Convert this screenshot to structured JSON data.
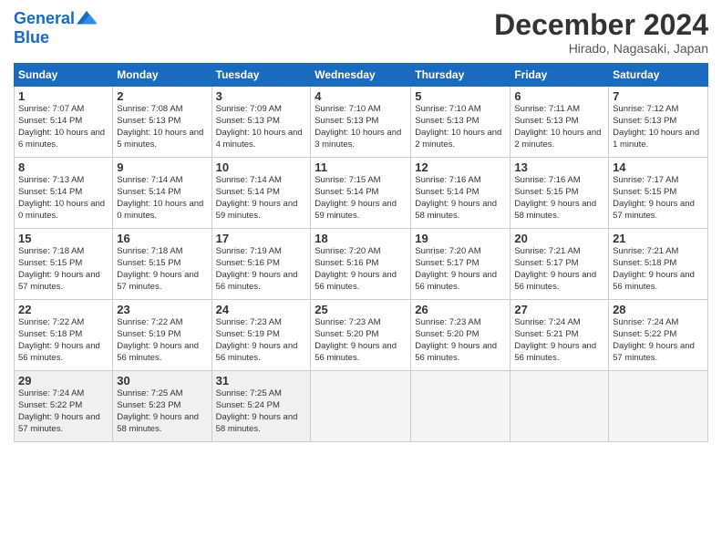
{
  "header": {
    "logo_line1": "General",
    "logo_line2": "Blue",
    "month": "December 2024",
    "location": "Hirado, Nagasaki, Japan"
  },
  "days_of_week": [
    "Sunday",
    "Monday",
    "Tuesday",
    "Wednesday",
    "Thursday",
    "Friday",
    "Saturday"
  ],
  "weeks": [
    [
      {
        "day": "1",
        "sunrise": "7:07 AM",
        "sunset": "5:14 PM",
        "daylight": "10 hours and 6 minutes."
      },
      {
        "day": "2",
        "sunrise": "7:08 AM",
        "sunset": "5:13 PM",
        "daylight": "10 hours and 5 minutes."
      },
      {
        "day": "3",
        "sunrise": "7:09 AM",
        "sunset": "5:13 PM",
        "daylight": "10 hours and 4 minutes."
      },
      {
        "day": "4",
        "sunrise": "7:10 AM",
        "sunset": "5:13 PM",
        "daylight": "10 hours and 3 minutes."
      },
      {
        "day": "5",
        "sunrise": "7:10 AM",
        "sunset": "5:13 PM",
        "daylight": "10 hours and 2 minutes."
      },
      {
        "day": "6",
        "sunrise": "7:11 AM",
        "sunset": "5:13 PM",
        "daylight": "10 hours and 2 minutes."
      },
      {
        "day": "7",
        "sunrise": "7:12 AM",
        "sunset": "5:13 PM",
        "daylight": "10 hours and 1 minute."
      }
    ],
    [
      {
        "day": "8",
        "sunrise": "7:13 AM",
        "sunset": "5:14 PM",
        "daylight": "10 hours and 0 minutes."
      },
      {
        "day": "9",
        "sunrise": "7:14 AM",
        "sunset": "5:14 PM",
        "daylight": "10 hours and 0 minutes."
      },
      {
        "day": "10",
        "sunrise": "7:14 AM",
        "sunset": "5:14 PM",
        "daylight": "9 hours and 59 minutes."
      },
      {
        "day": "11",
        "sunrise": "7:15 AM",
        "sunset": "5:14 PM",
        "daylight": "9 hours and 59 minutes."
      },
      {
        "day": "12",
        "sunrise": "7:16 AM",
        "sunset": "5:14 PM",
        "daylight": "9 hours and 58 minutes."
      },
      {
        "day": "13",
        "sunrise": "7:16 AM",
        "sunset": "5:15 PM",
        "daylight": "9 hours and 58 minutes."
      },
      {
        "day": "14",
        "sunrise": "7:17 AM",
        "sunset": "5:15 PM",
        "daylight": "9 hours and 57 minutes."
      }
    ],
    [
      {
        "day": "15",
        "sunrise": "7:18 AM",
        "sunset": "5:15 PM",
        "daylight": "9 hours and 57 minutes."
      },
      {
        "day": "16",
        "sunrise": "7:18 AM",
        "sunset": "5:15 PM",
        "daylight": "9 hours and 57 minutes."
      },
      {
        "day": "17",
        "sunrise": "7:19 AM",
        "sunset": "5:16 PM",
        "daylight": "9 hours and 56 minutes."
      },
      {
        "day": "18",
        "sunrise": "7:20 AM",
        "sunset": "5:16 PM",
        "daylight": "9 hours and 56 minutes."
      },
      {
        "day": "19",
        "sunrise": "7:20 AM",
        "sunset": "5:17 PM",
        "daylight": "9 hours and 56 minutes."
      },
      {
        "day": "20",
        "sunrise": "7:21 AM",
        "sunset": "5:17 PM",
        "daylight": "9 hours and 56 minutes."
      },
      {
        "day": "21",
        "sunrise": "7:21 AM",
        "sunset": "5:18 PM",
        "daylight": "9 hours and 56 minutes."
      }
    ],
    [
      {
        "day": "22",
        "sunrise": "7:22 AM",
        "sunset": "5:18 PM",
        "daylight": "9 hours and 56 minutes."
      },
      {
        "day": "23",
        "sunrise": "7:22 AM",
        "sunset": "5:19 PM",
        "daylight": "9 hours and 56 minutes."
      },
      {
        "day": "24",
        "sunrise": "7:23 AM",
        "sunset": "5:19 PM",
        "daylight": "9 hours and 56 minutes."
      },
      {
        "day": "25",
        "sunrise": "7:23 AM",
        "sunset": "5:20 PM",
        "daylight": "9 hours and 56 minutes."
      },
      {
        "day": "26",
        "sunrise": "7:23 AM",
        "sunset": "5:20 PM",
        "daylight": "9 hours and 56 minutes."
      },
      {
        "day": "27",
        "sunrise": "7:24 AM",
        "sunset": "5:21 PM",
        "daylight": "9 hours and 56 minutes."
      },
      {
        "day": "28",
        "sunrise": "7:24 AM",
        "sunset": "5:22 PM",
        "daylight": "9 hours and 57 minutes."
      }
    ],
    [
      {
        "day": "29",
        "sunrise": "7:24 AM",
        "sunset": "5:22 PM",
        "daylight": "9 hours and 57 minutes."
      },
      {
        "day": "30",
        "sunrise": "7:25 AM",
        "sunset": "5:23 PM",
        "daylight": "9 hours and 58 minutes."
      },
      {
        "day": "31",
        "sunrise": "7:25 AM",
        "sunset": "5:24 PM",
        "daylight": "9 hours and 58 minutes."
      },
      null,
      null,
      null,
      null
    ]
  ]
}
